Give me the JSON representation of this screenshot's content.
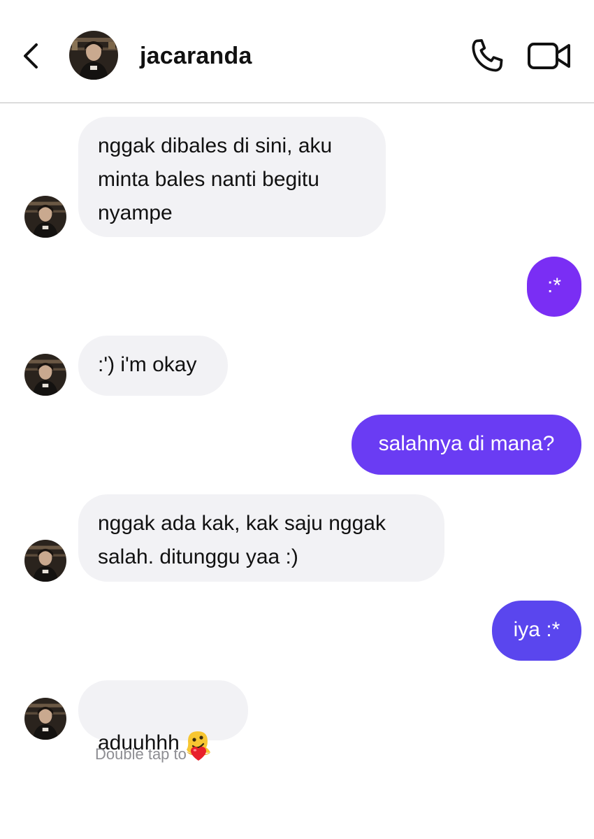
{
  "header": {
    "contact_name": "jacaranda",
    "back_icon": "chevron-left-icon",
    "call_icon": "phone-icon",
    "video_icon": "video-camera-icon"
  },
  "colors": {
    "incoming_bubble": "#f2f2f5",
    "outgoing_bubble_1": "#7a2ef4",
    "outgoing_bubble_2": "#6a3cf3",
    "outgoing_bubble_3": "#5a46ee",
    "divider": "#dcdcdc",
    "hint_text": "#8e8e93"
  },
  "messages": [
    {
      "direction": "incoming",
      "text": "nggak dibales di sini, aku\nminta bales nanti begitu\nnyampe"
    },
    {
      "direction": "outgoing",
      "text": ":*"
    },
    {
      "direction": "incoming",
      "text": ":') i'm okay"
    },
    {
      "direction": "outgoing",
      "text": "salahnya di mana?"
    },
    {
      "direction": "incoming",
      "text": "nggak ada kak, kak saju nggak\nsalah. ditunggu yaa :)"
    },
    {
      "direction": "outgoing",
      "text": "iya :*"
    },
    {
      "direction": "incoming",
      "text": "aduuhhh",
      "emoji": "melting-face-emoji"
    }
  ],
  "hint": {
    "text": "Double tap to",
    "icon": "heart-icon"
  }
}
